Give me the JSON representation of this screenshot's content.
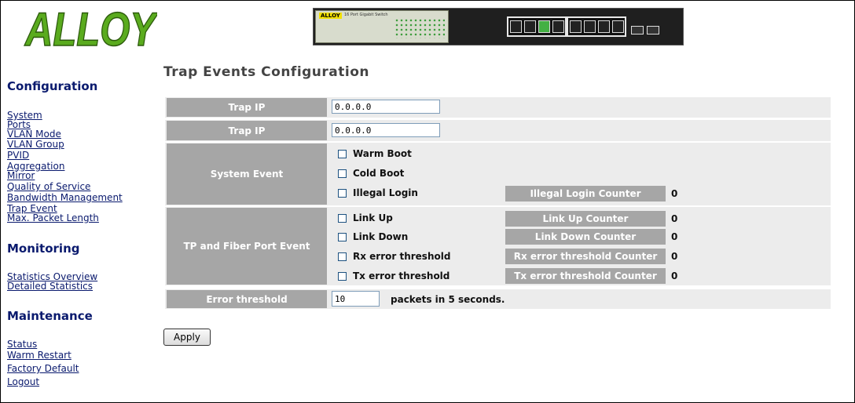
{
  "header": {
    "logo_text": "ALLOY",
    "device_brand": "ALLOY",
    "device_model": "16 Port Gigabit Switch"
  },
  "sidebar": {
    "sections": [
      {
        "title": "Configuration",
        "items": [
          "System",
          "Ports",
          "VLAN Mode",
          "VLAN Group",
          "PVID",
          "Aggregation",
          "Mirror",
          "Quality of Service",
          "Bandwidth Management",
          "Trap Event",
          "Max. Packet Length"
        ]
      },
      {
        "title": "Monitoring",
        "items": [
          "Statistics Overview",
          "Detailed Statistics"
        ]
      },
      {
        "title": "Maintenance",
        "items": [
          "Status",
          "Warm Restart",
          "Factory Default",
          "Logout"
        ]
      }
    ]
  },
  "main": {
    "title": "Trap Events Configuration",
    "trap_ip_rows": [
      {
        "label": "Trap IP",
        "value": "0.0.0.0"
      },
      {
        "label": "Trap IP",
        "value": "0.0.0.0"
      }
    ],
    "system_event": {
      "label": "System Event",
      "options": [
        {
          "label": "Warm Boot",
          "checked": false
        },
        {
          "label": "Cold Boot",
          "checked": false
        },
        {
          "label": "Illegal Login",
          "checked": false,
          "counter_label": "Illegal Login Counter",
          "counter_value": "0"
        }
      ]
    },
    "port_event": {
      "label": "TP and Fiber Port Event",
      "options": [
        {
          "label": "Link Up",
          "checked": false,
          "counter_label": "Link Up Counter",
          "counter_value": "0"
        },
        {
          "label": "Link Down",
          "checked": false,
          "counter_label": "Link Down Counter",
          "counter_value": "0"
        },
        {
          "label": "Rx error threshold",
          "checked": false,
          "counter_label": "Rx error threshold Counter",
          "counter_value": "0"
        },
        {
          "label": "Tx error threshold",
          "checked": false,
          "counter_label": "Tx error threshold Counter",
          "counter_value": "0"
        }
      ]
    },
    "error_threshold": {
      "label": "Error threshold",
      "value": "10",
      "suffix": "packets in 5 seconds."
    },
    "apply_label": "Apply"
  },
  "colors": {
    "nav_link": "#0a1a6e",
    "logo_green": "#5aab1e",
    "label_cell_bg": "#a6a6a6",
    "row_bg": "#ececec",
    "title_text": "#444444"
  }
}
